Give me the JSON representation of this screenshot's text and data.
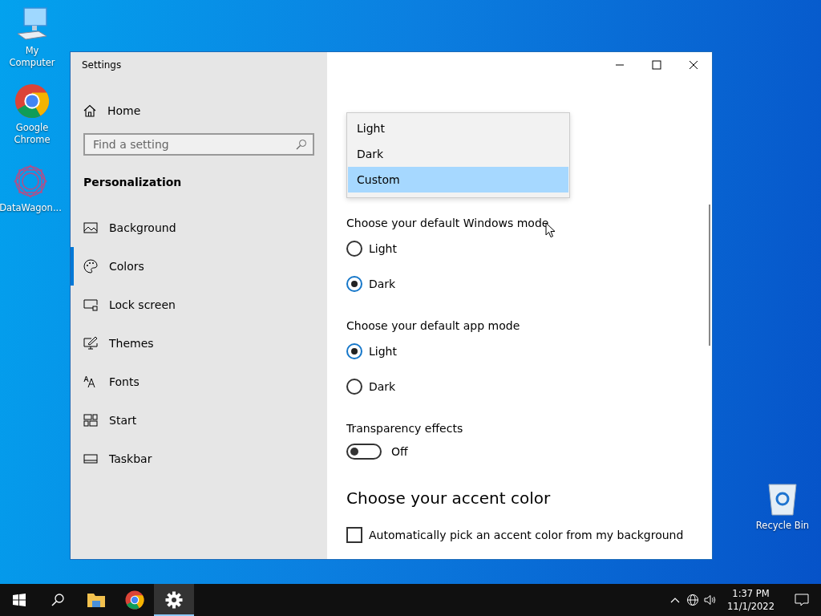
{
  "desktop_icons": [
    {
      "kind": "computer",
      "label": "My Computer"
    },
    {
      "kind": "chrome",
      "label": "Google Chrome"
    },
    {
      "kind": "app",
      "label": "DataWagon..."
    },
    {
      "kind": "recycle",
      "label": "Recycle Bin"
    }
  ],
  "window": {
    "title": "Settings"
  },
  "sidebar": {
    "home": "Home",
    "search": {
      "placeholder": "Find a setting"
    },
    "section": "Personalization",
    "items": [
      {
        "kind": "image",
        "label": "Background",
        "selected": false
      },
      {
        "kind": "palette",
        "label": "Colors",
        "selected": true
      },
      {
        "kind": "lock",
        "label": "Lock screen",
        "selected": false
      },
      {
        "kind": "themes",
        "label": "Themes",
        "selected": false
      },
      {
        "kind": "fonts",
        "label": "Fonts",
        "selected": false
      },
      {
        "kind": "start",
        "label": "Start",
        "selected": false
      },
      {
        "kind": "taskbar",
        "label": "Taskbar",
        "selected": false
      }
    ]
  },
  "main": {
    "dropdown": {
      "options": [
        {
          "label": "Light",
          "selected": false
        },
        {
          "label": "Dark",
          "selected": false
        },
        {
          "label": "Custom",
          "selected": true
        }
      ]
    },
    "windows_mode": {
      "label": "Choose your default Windows mode",
      "options": [
        {
          "label": "Light",
          "selected": false
        },
        {
          "label": "Dark",
          "selected": true
        }
      ]
    },
    "app_mode": {
      "label": "Choose your default app mode",
      "options": [
        {
          "label": "Light",
          "selected": true
        },
        {
          "label": "Dark",
          "selected": false
        }
      ]
    },
    "transparency": {
      "label": "Transparency effects",
      "on": false,
      "state": "Off"
    },
    "accent_heading": "Choose your accent color",
    "auto_accent": {
      "label": "Automatically pick an accent color from my background",
      "checked": false
    }
  },
  "taskbar": {
    "apps": [
      {
        "kind": "explorer",
        "active": false
      },
      {
        "kind": "chrome",
        "active": false
      },
      {
        "kind": "settings",
        "active": true
      }
    ],
    "time": "1:37 PM",
    "date": "11/1/2022"
  }
}
